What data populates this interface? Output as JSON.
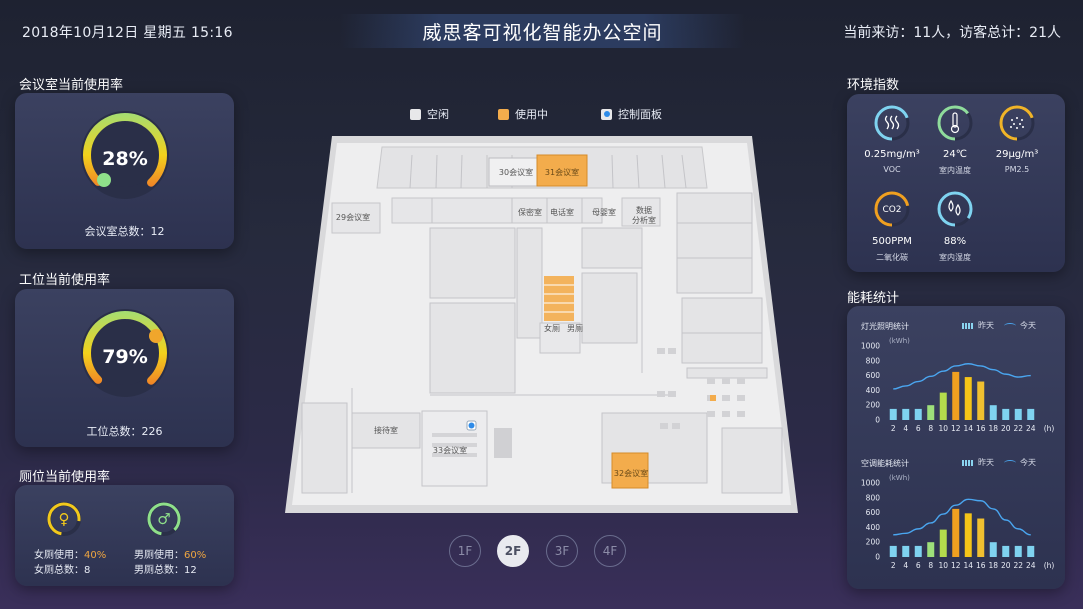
{
  "header": {
    "datetime": "2018年10月12日  星期五  15:16",
    "title": "威思客可视化智能办公空间",
    "visitors": "当前来访：11人，访客总计：21人"
  },
  "meeting": {
    "title": "会议室当前使用率",
    "percent_label": "28%",
    "usage": 0.28,
    "caption": "会议室总数：12"
  },
  "workstation": {
    "title": "工位当前使用率",
    "percent_label": "79%",
    "usage": 0.79,
    "caption": "工位总数：226"
  },
  "restroom": {
    "title": "厕位当前使用率",
    "female": {
      "usage_label": "女厕使用：",
      "usage_value": "40%",
      "usage": 0.4,
      "total_label": "女厕总数：",
      "total_value": "8"
    },
    "male": {
      "usage_label": "男厕使用：",
      "usage_value": "60%",
      "usage": 0.6,
      "total_label": "男厕总数：",
      "total_value": "12"
    }
  },
  "legend": {
    "idle": "空闲",
    "in_use": "使用中",
    "control": "控制面板"
  },
  "floorplan": {
    "rooms": {
      "r30": "30会议室",
      "r31": "31会议室",
      "r29": "29会议室",
      "baomi": "保密室",
      "dianhua": "电话室",
      "muying": "母婴室",
      "shuju1": "数据",
      "shuju2": "分析室",
      "nv": "女厕",
      "nan": "男厕",
      "jiedai": "接待室",
      "r33": "33会议室",
      "r32": "32会议室"
    }
  },
  "floors": [
    "1F",
    "2F",
    "3F",
    "4F"
  ],
  "active_floor": "2F",
  "environment": {
    "title": "环境指数",
    "items": [
      {
        "value": "0.25mg/m³",
        "label": "VOC",
        "icon": "voc-waves-icon",
        "color": "#7fd3f0"
      },
      {
        "value": "24℃",
        "label": "室内温度",
        "icon": "thermometer-icon",
        "color": "#8fdc9c"
      },
      {
        "value": "29μg/m³",
        "label": "PM2.5",
        "icon": "pm25-dots-icon",
        "color": "#f0b428"
      },
      {
        "value": "500PPM",
        "label": "二氧化碳",
        "icon": "co2-icon",
        "color": "#f0a020"
      },
      {
        "value": "88%",
        "label": "室内湿度",
        "icon": "humidity-drops-icon",
        "color": "#7fd3f0"
      }
    ]
  },
  "energy": {
    "title": "能耗统计",
    "legend_yesterday": "昨天",
    "legend_today": "今天",
    "charts": [
      {
        "title": "灯光照明统计",
        "unit": "(kWh)"
      },
      {
        "title": "空调能耗统计",
        "unit": "(kWh)"
      }
    ]
  },
  "chart_data": [
    {
      "type": "bar",
      "title": "灯光照明统计",
      "ylabel": "(kWh)",
      "xlabel": "(h)",
      "categories": [
        "2",
        "4",
        "6",
        "8",
        "10",
        "12",
        "14",
        "16",
        "18",
        "20",
        "22",
        "24"
      ],
      "ylim": [
        0,
        1000
      ],
      "yticks": [
        "0",
        "200",
        "400",
        "600",
        "800",
        "1000"
      ],
      "series": [
        {
          "name": "昨天",
          "values": [
            150,
            150,
            150,
            200,
            370,
            650,
            580,
            520,
            200,
            150,
            150,
            150
          ]
        },
        {
          "name": "今天",
          "values": [
            420,
            460,
            520,
            590,
            660,
            730,
            760,
            730,
            680,
            620,
            580,
            600
          ]
        }
      ]
    },
    {
      "type": "bar",
      "title": "空调能耗统计",
      "ylabel": "(kWh)",
      "xlabel": "(h)",
      "categories": [
        "2",
        "4",
        "6",
        "8",
        "10",
        "12",
        "14",
        "16",
        "18",
        "20",
        "22",
        "24"
      ],
      "ylim": [
        0,
        1000
      ],
      "yticks": [
        "0",
        "200",
        "400",
        "600",
        "800",
        "1000"
      ],
      "series": [
        {
          "name": "昨天",
          "values": [
            150,
            150,
            150,
            200,
            370,
            650,
            590,
            520,
            200,
            150,
            150,
            150
          ]
        },
        {
          "name": "今天",
          "values": [
            300,
            320,
            380,
            460,
            580,
            700,
            780,
            760,
            650,
            500,
            380,
            300
          ]
        }
      ]
    }
  ]
}
